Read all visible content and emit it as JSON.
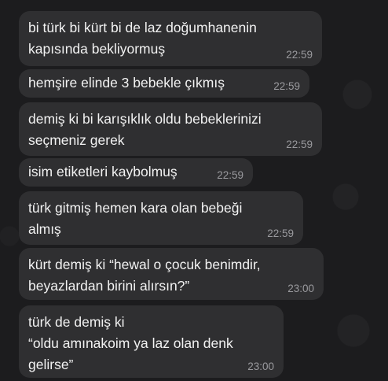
{
  "messages": [
    {
      "text": "bi türk bi kürt bi de laz doğumhanenin\nkapısında bekliyormuş",
      "time": "22:59"
    },
    {
      "text": "hemşire elinde 3 bebekle çıkmış",
      "time": "22:59"
    },
    {
      "text": "demiş ki bi karışıklık oldu bebeklerinizi\nseçmeniz gerek",
      "time": "22:59"
    },
    {
      "text": "isim etiketleri kaybolmuş",
      "time": "22:59"
    },
    {
      "text": "türk gitmiş hemen kara olan bebeği\nalmış",
      "time": "22:59"
    },
    {
      "text": "kürt demiş ki “hewal o çocuk benimdir,\nbeyazlardan birini alırsın?”",
      "time": "23:00"
    },
    {
      "text": "türk de demiş ki\n“oldu amınakoim ya laz olan denk\ngelirse”",
      "time": "23:00"
    }
  ]
}
